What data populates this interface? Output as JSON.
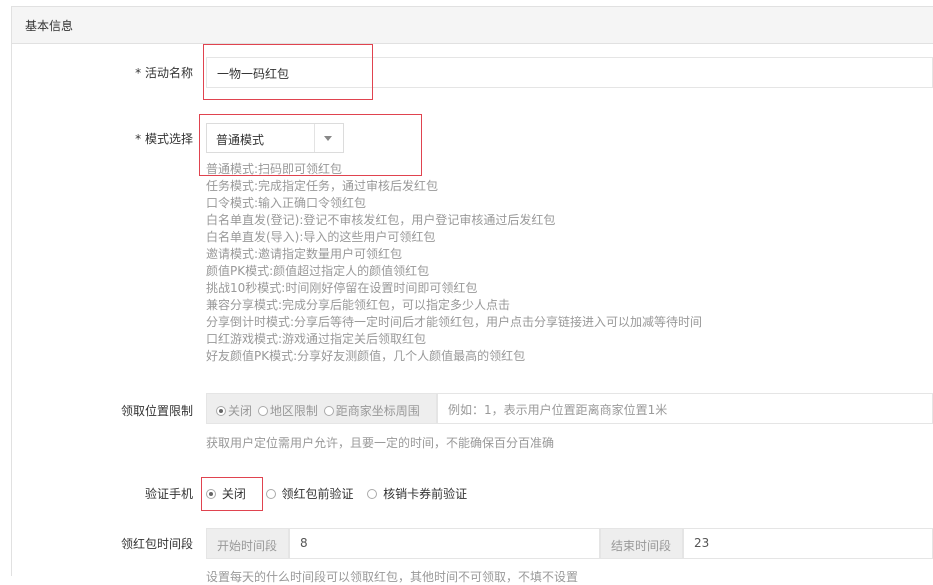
{
  "panel": {
    "title": "基本信息"
  },
  "activity_name": {
    "required_mark": "*",
    "label": "活动名称",
    "value": "一物一码红包"
  },
  "mode_select": {
    "required_mark": "*",
    "label": "模式选择",
    "selected": "普通模式",
    "descriptions": [
      "普通模式:扫码即可领红包",
      "任务模式:完成指定任务，通过审核后发红包",
      "口令模式:输入正确口令领红包",
      "白名单直发(登记):登记不审核发红包，用户登记审核通过后发红包",
      "白名单直发(导入):导入的这些用户可领红包",
      "邀请模式:邀请指定数量用户可领红包",
      "颜值PK模式:颜值超过指定人的颜值领红包",
      "挑战10秒模式:时间刚好停留在设置时间即可领红包",
      "兼容分享模式:完成分享后能领红包，可以指定多少人点击",
      "分享倒计时模式:分享后等待一定时间后才能领红包，用户点击分享链接进入可以加减等待时间",
      "口红游戏模式:游戏通过指定关后领取红包",
      "好友颜值PK模式:分享好友测颜值，几个人颜值最高的领红包"
    ]
  },
  "location_limit": {
    "label": "领取位置限制",
    "options": [
      "关闭",
      "地区限制",
      "距商家坐标周围"
    ],
    "selected": "关闭",
    "placeholder": "例如：1，表示用户位置距离商家位置1米",
    "hint": "获取用户定位需用户允许，且要一定的时间，不能确保百分百准确"
  },
  "verify_phone": {
    "label": "验证手机",
    "options": [
      "关闭",
      "领红包前验证",
      "核销卡券前验证"
    ],
    "selected": "关闭"
  },
  "time_period": {
    "label": "领红包时间段",
    "start_label": "开始时间段",
    "start_value": "8",
    "end_label": "结束时间段",
    "end_value": "23",
    "hint": "设置每天的什么时间段可以领取红包，其他时间不可领取，不填不设置"
  },
  "colors": {
    "highlight_border": "#e0434f",
    "muted_text": "#999999"
  }
}
